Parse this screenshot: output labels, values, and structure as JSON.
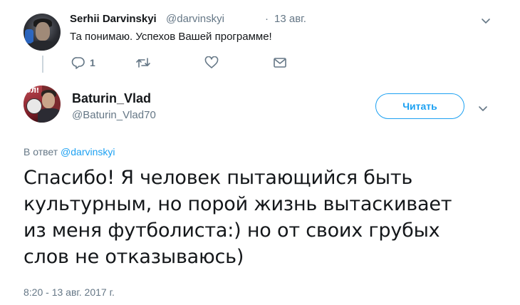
{
  "reply_tweet": {
    "author_name": "Serhii Darvinskyi",
    "author_handle": "@darvinskyi",
    "separator": "·",
    "time": "13 авг.",
    "text": "Та понимаю. Успехов Вашей программе!",
    "reply_count": "1",
    "icons": [
      "reply-icon",
      "retweet-icon",
      "like-icon",
      "direct-message-icon",
      "chevron-down-icon"
    ]
  },
  "main_tweet": {
    "author_name": "Baturin_Vlad",
    "author_handle": "@Baturin_Vlad70",
    "follow_label": "Читать",
    "reply_prefix": "В ответ ",
    "reply_mention": "@darvinskyi",
    "text_lines": [
      "Спасибо! Я человек пытающийся быть",
      "культурным, но порой жизнь вытаскивает",
      "из меня футболиста:) но от своих грубых",
      "слов не отказываюсь)"
    ],
    "timestamp": "8:20 - 13 авг. 2017 г."
  },
  "colors": {
    "accent": "#1da1f2",
    "secondary_text": "#657786",
    "primary_text": "#14171a",
    "thread_line": "#ccd6dd"
  }
}
